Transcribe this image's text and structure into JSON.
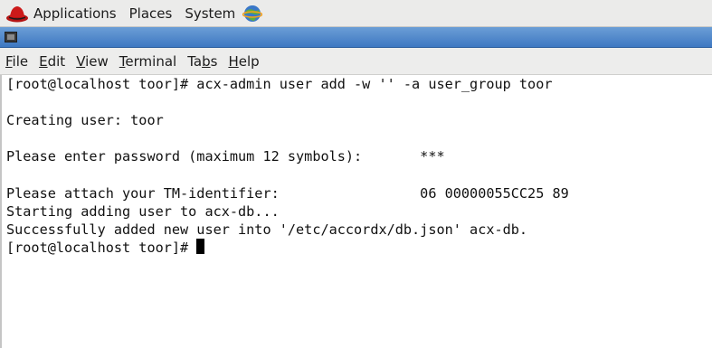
{
  "panel": {
    "items": [
      "Applications",
      "Places",
      "System"
    ]
  },
  "window": {
    "title": ""
  },
  "menubar": {
    "items": [
      "File",
      "Edit",
      "View",
      "Terminal",
      "Tabs",
      "Help"
    ]
  },
  "terminal": {
    "lines": [
      "[root@localhost toor]# acx-admin user add -w '' -a user_group toor",
      "",
      "Creating user: toor",
      "",
      "Please enter password (maximum 12 symbols):       ***",
      "",
      "Please attach your TM-identifier:                 06 00000055CC25 89",
      "Starting adding user to acx-db...",
      "Successfully added new user into '/etc/accordx/db.json' acx-db.",
      "[root@localhost toor]# "
    ]
  }
}
